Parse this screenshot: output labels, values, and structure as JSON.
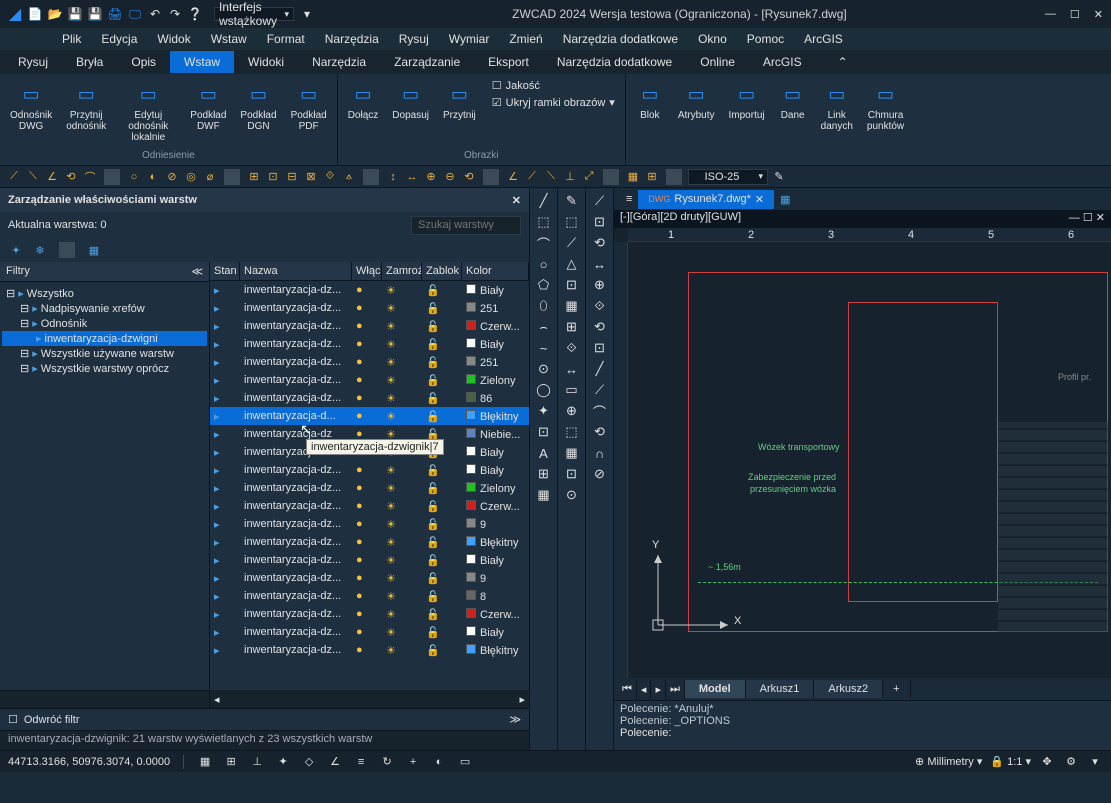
{
  "title": "ZWCAD 2024 Wersja testowa (Ograniczona) - [Rysunek7.dwg]",
  "qat_dropdown": "Interfejs wstążkowy",
  "menus": [
    "Plik",
    "Edycja",
    "Widok",
    "Wstaw",
    "Format",
    "Narzędzia",
    "Rysuj",
    "Wymiar",
    "Zmień",
    "Narzędzia dodatkowe",
    "Okno",
    "Pomoc",
    "ArcGIS"
  ],
  "ribbon_tabs": [
    "Rysuj",
    "Bryła",
    "Opis",
    "Wstaw",
    "Widoki",
    "Narzędzia",
    "Zarządzanie",
    "Eksport",
    "Narzędzia dodatkowe",
    "Online",
    "ArcGIS"
  ],
  "ribbon_active": 3,
  "panel_ref": {
    "label": "Odniesienie",
    "btns": [
      {
        "l": "Odnośnik\nDWG"
      },
      {
        "l": "Przytnij\nodnośnik"
      },
      {
        "l": "Edytuj odnośnik\nlokalnie"
      },
      {
        "l": "Podkład\nDWF"
      },
      {
        "l": "Podkład\nDGN"
      },
      {
        "l": "Podkład\nPDF"
      }
    ]
  },
  "panel_img": {
    "label": "Obrazki",
    "btns": [
      {
        "l": "Dołącz"
      },
      {
        "l": "Dopasuj"
      },
      {
        "l": "Przytnij"
      }
    ],
    "opt1": "Jakość",
    "opt2": "Ukryj ramki obrazów"
  },
  "panel_blk": {
    "btns": [
      {
        "l": "Blok"
      },
      {
        "l": "Atrybuty"
      },
      {
        "l": "Importuj"
      },
      {
        "l": "Dane"
      },
      {
        "l": "Link\ndanych"
      },
      {
        "l": "Chmura\npunktów"
      }
    ]
  },
  "iso_combo": "ISO-25",
  "layer_panel": {
    "title": "Zarządzanie właściwościami warstw",
    "current": "Aktualna warstwa: 0",
    "search_ph": "Szukaj warstwy",
    "filters_hdr": "Filtry",
    "tree": [
      {
        "l": "Wszystko",
        "lvl": 0
      },
      {
        "l": "Nadpisywanie xrefów",
        "lvl": 1
      },
      {
        "l": "Odnośnik",
        "lvl": 1
      },
      {
        "l": "inwentaryzacja-dzwigni",
        "lvl": 2,
        "sel": true
      },
      {
        "l": "Wszystkie używane warstw",
        "lvl": 1
      },
      {
        "l": "Wszystkie warstwy oprócz",
        "lvl": 1
      }
    ],
    "cols": [
      "Stan",
      "Nazwa",
      "Włąc",
      "Zamroź",
      "Zablok",
      "Kolor"
    ],
    "rows": [
      {
        "n": "inwentaryzacja-dz...",
        "c": "#fff",
        "cn": "Biały"
      },
      {
        "n": "inwentaryzacja-dz...",
        "c": "#888",
        "cn": "251"
      },
      {
        "n": "inwentaryzacja-dz...",
        "c": "#d02020",
        "cn": "Czerw..."
      },
      {
        "n": "inwentaryzacja-dz...",
        "c": "#fff",
        "cn": "Biały"
      },
      {
        "n": "inwentaryzacja-dz...",
        "c": "#888",
        "cn": "251"
      },
      {
        "n": "inwentaryzacja-dz...",
        "c": "#20c020",
        "cn": "Zielony"
      },
      {
        "n": "inwentaryzacja-dz...",
        "c": "#486048",
        "cn": "86"
      },
      {
        "n": "inwentaryzacja-d...",
        "c": "#40a0ff",
        "cn": "Błękitny",
        "sel": true
      },
      {
        "n": "inwentaryzacja-dz",
        "c": "#6080c0",
        "cn": "Niebie..."
      },
      {
        "n": "inwentaryzacja-dz...",
        "c": "#fff",
        "cn": "Biały"
      },
      {
        "n": "inwentaryzacja-dz...",
        "c": "#fff",
        "cn": "Biały"
      },
      {
        "n": "inwentaryzacja-dz...",
        "c": "#20c020",
        "cn": "Zielony"
      },
      {
        "n": "inwentaryzacja-dz...",
        "c": "#d02020",
        "cn": "Czerw..."
      },
      {
        "n": "inwentaryzacja-dz...",
        "c": "#888",
        "cn": "9"
      },
      {
        "n": "inwentaryzacja-dz...",
        "c": "#40a0ff",
        "cn": "Błękitny"
      },
      {
        "n": "inwentaryzacja-dz...",
        "c": "#fff",
        "cn": "Biały"
      },
      {
        "n": "inwentaryzacja-dz...",
        "c": "#888",
        "cn": "9"
      },
      {
        "n": "inwentaryzacja-dz...",
        "c": "#666",
        "cn": "8"
      },
      {
        "n": "inwentaryzacja-dz...",
        "c": "#d02020",
        "cn": "Czerw..."
      },
      {
        "n": "inwentaryzacja-dz...",
        "c": "#fff",
        "cn": "Biały"
      },
      {
        "n": "inwentaryzacja-dz...",
        "c": "#40a0ff",
        "cn": "Błękitny"
      }
    ],
    "tooltip": "inwentaryzacja-dzwignik|7",
    "invert": "Odwróć filtr",
    "status": "inwentaryzacja-dzwignik: 21 warstw wyświetlanych z 23 wszystkich warstw"
  },
  "doc_tab": "Rysunek7.dwg*",
  "view_label": "[-][Góra][2D druty][GUW]",
  "ruler_marks": [
    "1",
    "2",
    "3",
    "4",
    "5",
    "6"
  ],
  "drawing_text": [
    "Wózek transportowy",
    "Zabezpieczenie przed",
    "przesunięciem wózka",
    "~ 1,56m",
    "Profil pr."
  ],
  "model_tabs": [
    "Model",
    "Arkusz1",
    "Arkusz2"
  ],
  "cmd_lines": [
    "Polecenie: *Anuluj*",
    "Polecenie: _OPTIONS"
  ],
  "cmd_prompt": "Polecenie:",
  "coords": "44713.3166, 50976.3074, 0.0000",
  "status_units": "Millimetry",
  "status_scale": "1:1",
  "axes": {
    "x": "X",
    "y": "Y"
  }
}
